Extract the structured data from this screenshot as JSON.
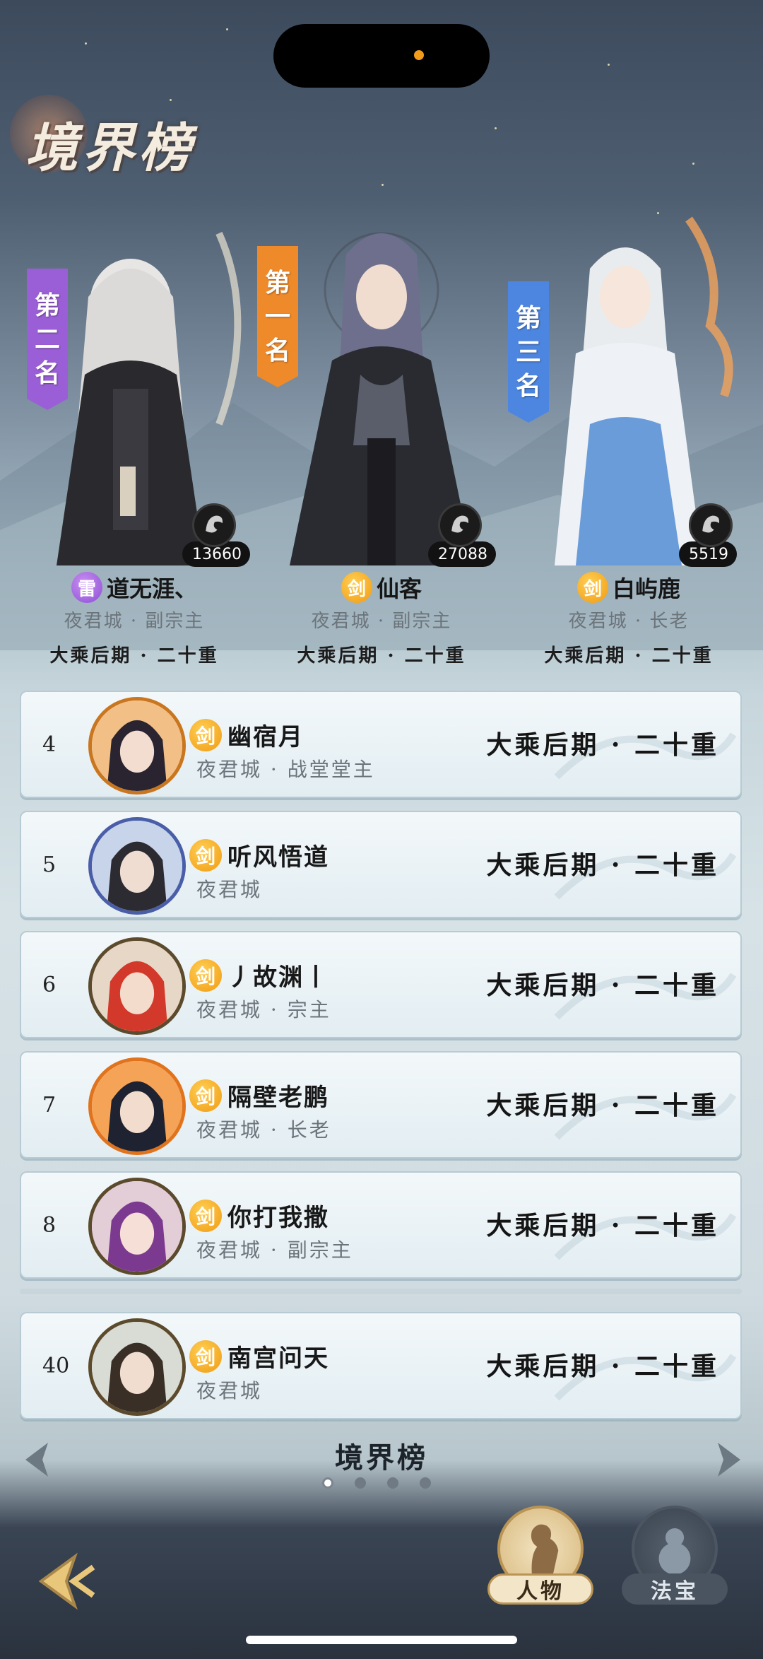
{
  "board": {
    "title": "境界榜"
  },
  "top3": [
    {
      "rank_text": [
        "第",
        "二",
        "名"
      ],
      "power": "13660",
      "element": "雷",
      "name": "道无涯、",
      "sect": "夜君城 · 副宗主",
      "realm": "大乘后期 · 二十重",
      "banner_color": "#9a5fd6"
    },
    {
      "rank_text": [
        "第",
        "一",
        "名"
      ],
      "power": "27088",
      "element": "剑",
      "name": "仙客",
      "sect": "夜君城 · 副宗主",
      "realm": "大乘后期 · 二十重",
      "banner_color": "#ee8a2a"
    },
    {
      "rank_text": [
        "第",
        "三",
        "名"
      ],
      "power": "5519",
      "element": "剑",
      "name": "白屿鹿",
      "sect": "夜君城 · 长老",
      "realm": "大乘后期 · 二十重",
      "banner_color": "#4d86e0"
    }
  ],
  "rows": [
    {
      "rank": "4",
      "element": "剑",
      "name": "幽宿月",
      "sect": "夜君城 · 战堂堂主",
      "realm": "大乘后期 · 二十重"
    },
    {
      "rank": "5",
      "element": "剑",
      "name": "听风悟道",
      "sect": "夜君城",
      "realm": "大乘后期 · 二十重"
    },
    {
      "rank": "6",
      "element": "剑",
      "name": "丿故渊丨",
      "sect": "夜君城 · 宗主",
      "realm": "大乘后期 · 二十重"
    },
    {
      "rank": "7",
      "element": "剑",
      "name": "隔壁老鹏",
      "sect": "夜君城 · 长老",
      "realm": "大乘后期 · 二十重"
    },
    {
      "rank": "8",
      "element": "剑",
      "name": "你打我撒",
      "sect": "夜君城 · 副宗主",
      "realm": "大乘后期 · 二十重"
    }
  ],
  "self_row": {
    "rank": "40",
    "element": "剑",
    "name": "南宫问天",
    "sect": "夜君城",
    "realm": "大乘后期 · 二十重"
  },
  "footer": {
    "page_label": "境界榜",
    "pages": 4,
    "active_page": 1,
    "tabs": [
      {
        "label": "人物",
        "active": true
      },
      {
        "label": "法宝",
        "active": false
      }
    ]
  },
  "icons": {
    "back": "back-arrow-icon",
    "prev": "left-arrow-icon",
    "next": "right-arrow-icon",
    "power": "power-rating-icon",
    "character_tab": "character-silhouette-icon",
    "treasure_tab": "gourd-icon"
  }
}
